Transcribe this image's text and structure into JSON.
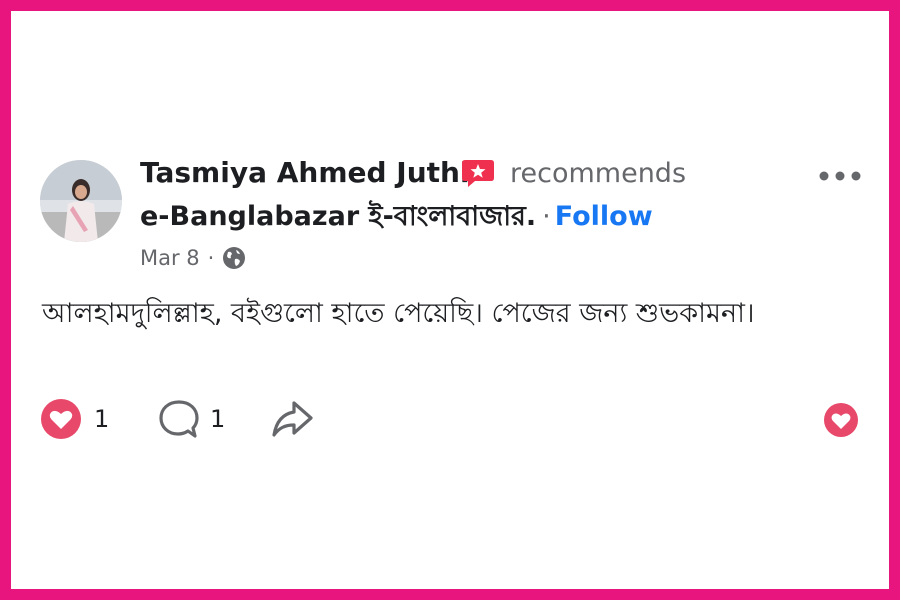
{
  "post": {
    "author_name": "Tasmiya Ahmed Juthi",
    "action_text": "recommends",
    "page_name": "e-Banglabazar ই-বাংলাবাজার.",
    "separator": "·",
    "follow_label": "Follow",
    "date": "Mar 8",
    "meta_separator": "·",
    "visibility_icon": "globe-icon",
    "body_text": "আলহামদুলিল্লাহ, বইগুলো হাতে পেয়েছি। পেজের জন্য শুভকামনা।"
  },
  "actions": {
    "like_count": "1",
    "comment_count": "1",
    "share_icon": "share-icon",
    "react_icon": "love-icon"
  },
  "colors": {
    "frame": "#e8157f",
    "link": "#1877f2",
    "reaction": "#e8486a",
    "text": "#1c1e21",
    "muted": "#65676b"
  }
}
